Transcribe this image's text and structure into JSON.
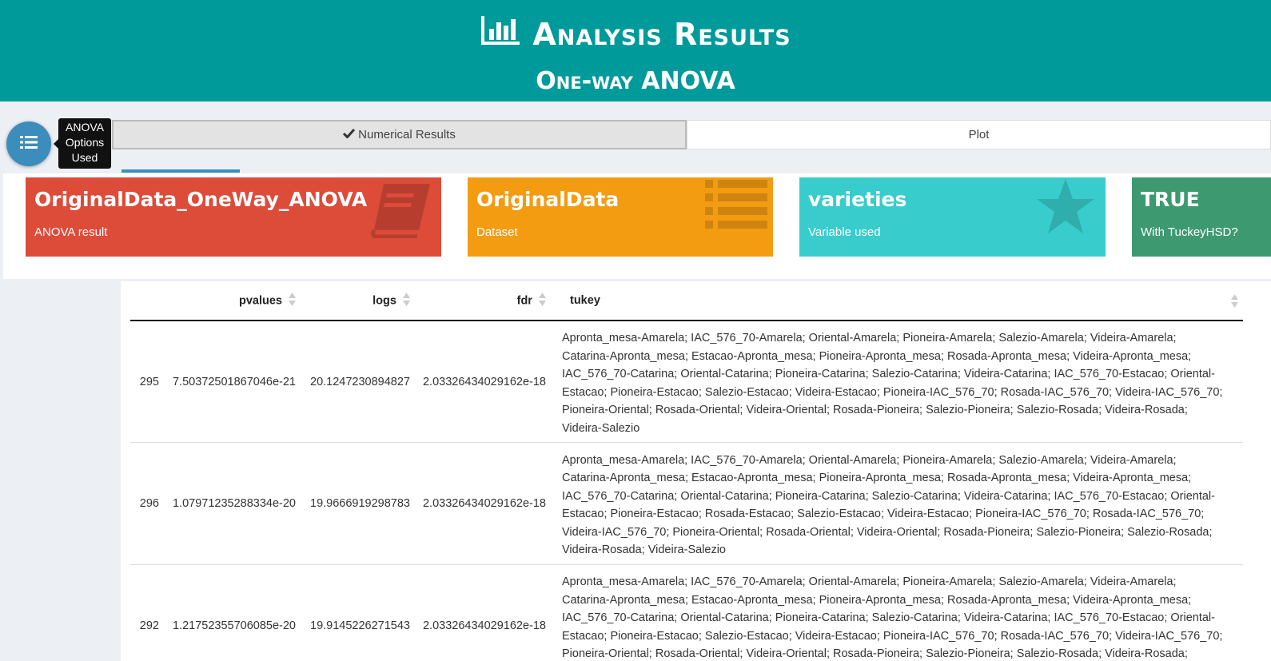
{
  "header": {
    "title": "Analysis Results",
    "subtitle": "One-way ANOVA",
    "title_icon": "bar-chart-icon"
  },
  "options_button": {
    "icon": "list-icon",
    "tooltip": "ANOVA Options Used"
  },
  "tabs": [
    {
      "label": "Numerical Results",
      "icon": "check-icon",
      "active": true
    },
    {
      "label": "Plot",
      "active": false
    }
  ],
  "value_boxes": [
    {
      "value": "OriginalData_OneWay_ANOVA",
      "subtitle": "ANOVA result",
      "color": "#dd4b39",
      "icon": "book-icon"
    },
    {
      "value": "OriginalData",
      "subtitle": "Dataset",
      "color": "#f39c12",
      "icon": "list-icon"
    },
    {
      "value": "varieties",
      "subtitle": "Variable used",
      "color": "#39cccc",
      "icon": "star-icon"
    },
    {
      "value": "TRUE",
      "subtitle": "With TuckeyHSD?",
      "color": "#3d9970",
      "icon": ""
    }
  ],
  "table": {
    "columns": [
      "",
      "pvalues",
      "logs",
      "fdr",
      "tukey"
    ],
    "rows": [
      {
        "id": "295",
        "pvalues": "7.50372501867046e-21",
        "logs": "20.1247230894827",
        "fdr": "2.03326434029162e-18",
        "tukey": "Apronta_mesa-Amarela; IAC_576_70-Amarela; Oriental-Amarela; Pioneira-Amarela; Salezio-Amarela; Videira-Amarela; Catarina-Apronta_mesa; Estacao-Apronta_mesa; Pioneira-Apronta_mesa; Rosada-Apronta_mesa; Videira-Apronta_mesa; IAC_576_70-Catarina; Oriental-Catarina; Pioneira-Catarina; Salezio-Catarina; Videira-Catarina; IAC_576_70-Estacao; Oriental-Estacao; Pioneira-Estacao; Salezio-Estacao; Videira-Estacao; Pioneira-IAC_576_70; Rosada-IAC_576_70; Videira-IAC_576_70; Pioneira-Oriental; Rosada-Oriental; Videira-Oriental; Rosada-Pioneira; Salezio-Pioneira; Salezio-Rosada; Videira-Rosada; Videira-Salezio"
      },
      {
        "id": "296",
        "pvalues": "1.07971235288334e-20",
        "logs": "19.9666919298783",
        "fdr": "2.03326434029162e-18",
        "tukey": "Apronta_mesa-Amarela; IAC_576_70-Amarela; Oriental-Amarela; Pioneira-Amarela; Salezio-Amarela; Videira-Amarela; Catarina-Apronta_mesa; Estacao-Apronta_mesa; Pioneira-Apronta_mesa; Rosada-Apronta_mesa; Videira-Apronta_mesa; IAC_576_70-Catarina; Oriental-Catarina; Pioneira-Catarina; Salezio-Catarina; Videira-Catarina; IAC_576_70-Estacao; Oriental-Estacao; Pioneira-Estacao; Rosada-Estacao; Salezio-Estacao; Videira-Estacao; Pioneira-IAC_576_70; Rosada-IAC_576_70; Videira-IAC_576_70; Pioneira-Oriental; Rosada-Oriental; Videira-Oriental; Rosada-Pioneira; Salezio-Pioneira; Salezio-Rosada; Videira-Rosada; Videira-Salezio"
      },
      {
        "id": "292",
        "pvalues": "1.21752355706085e-20",
        "logs": "19.9145226271543",
        "fdr": "2.03326434029162e-18",
        "tukey": "Apronta_mesa-Amarela; IAC_576_70-Amarela; Oriental-Amarela; Pioneira-Amarela; Salezio-Amarela; Videira-Amarela; Catarina-Apronta_mesa; Estacao-Apronta_mesa; Pioneira-Apronta_mesa; Rosada-Apronta_mesa; Videira-Apronta_mesa; IAC_576_70-Catarina; Oriental-Catarina; Pioneira-Catarina; Salezio-Catarina; Videira-Catarina; IAC_576_70-Estacao; Oriental-Estacao; Pioneira-Estacao; Salezio-Estacao; Videira-Estacao; Pioneira-IAC_576_70; Rosada-IAC_576_70; Videira-IAC_576_70; Pioneira-Oriental; Rosada-Oriental; Videira-Oriental; Rosada-Pioneira; Salezio-Pioneira; Salezio-Rosada; Videira-Rosada; Videira-Salezio"
      }
    ]
  }
}
